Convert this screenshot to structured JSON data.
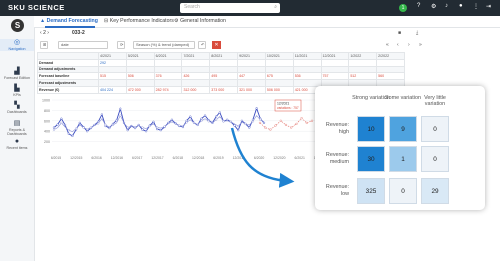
{
  "app": {
    "logo": "SKU SCIENCE",
    "search_placeholder": "Search",
    "badge": "1"
  },
  "sidebar": [
    {
      "icon": "compass-icon",
      "glyph": "◎",
      "label": "Navigation",
      "active": true
    },
    {
      "icon": "forecast-icon",
      "glyph": "▟",
      "label": "Forecast Edition"
    },
    {
      "icon": "kpi-icon",
      "glyph": "▙",
      "label": "KPIs"
    },
    {
      "icon": "dashboard-icon",
      "glyph": "▚",
      "label": "Dashboards"
    },
    {
      "icon": "reports-icon",
      "glyph": "▤",
      "label": "Reports & Dashboards"
    },
    {
      "icon": "recent-icon",
      "glyph": "●",
      "label": "Recent items"
    }
  ],
  "tabs": [
    {
      "label": "Demand Forecasting",
      "glyph": "▲",
      "active": true
    },
    {
      "label": "Key Performance Indicators",
      "glyph": "⊟"
    },
    {
      "label": "General Information",
      "glyph": "⚙"
    }
  ],
  "breadcrumb": {
    "page": "2",
    "code": "033-2"
  },
  "toolbar": {
    "period": "date",
    "filter": "Season (%) & trend (damped)"
  },
  "table": {
    "columns": [
      "",
      "4/2021",
      "5/2021",
      "6/2021",
      "7/2021",
      "8/2021",
      "9/2021",
      "10/2021",
      "11/2021",
      "12/2021",
      "1/2022",
      "2/2022"
    ],
    "rows": [
      {
        "label": "Demand",
        "values": [
          "292",
          "",
          "",
          "",
          "",
          "",
          "",
          "",
          "",
          "",
          ""
        ],
        "style": "blue"
      },
      {
        "label": "Demand adjustments",
        "values": [
          "",
          "",
          "",
          "",
          "",
          "",
          "",
          "",
          "",
          "",
          ""
        ],
        "style": "blue"
      },
      {
        "label": "Forecast baseline",
        "values": [
          "515",
          "506",
          "376",
          "426",
          "495",
          "447",
          "675",
          "536",
          "757",
          "512",
          "560"
        ],
        "style": "red"
      },
      {
        "label": "Forecast adjustments",
        "values": [
          "",
          "",
          "",
          "",
          "",
          "",
          "",
          "",
          "",
          "",
          ""
        ],
        "style": "red"
      },
      {
        "label": "Revenue (€)",
        "values": [
          "404 224",
          "472 000",
          "282 974",
          "312 000",
          "373 000",
          "321 000",
          "506 000",
          "421 000",
          "572 000",
          "389 000",
          "422 000"
        ],
        "style": "mixed"
      }
    ]
  },
  "chart_data": {
    "type": "line",
    "y_ticks": [
      "1000",
      "800",
      "600",
      "400",
      "200"
    ],
    "x_ticks": [
      "6/2015",
      "12/2015",
      "6/2016",
      "12/2016",
      "6/2017",
      "12/2017",
      "6/2018",
      "12/2018",
      "6/2019",
      "12/2019",
      "6/2020",
      "12/2020",
      "6/2021",
      "12/2021"
    ],
    "ylim": [
      0,
      1000
    ],
    "series": [
      {
        "values": [
          470,
          530,
          640,
          520,
          350,
          310,
          430,
          560,
          480,
          400,
          460,
          520,
          580,
          720,
          500,
          460,
          540,
          610,
          830,
          560,
          420,
          500,
          460,
          520,
          430,
          400,
          510,
          580,
          440,
          420,
          480,
          560,
          620,
          550,
          500,
          480,
          600,
          680,
          560,
          520,
          640,
          700,
          610,
          560,
          680,
          760,
          590,
          620,
          580,
          510,
          420,
          600,
          540,
          470,
          620,
          840,
          640,
          560
        ],
        "color": "#3b4cc0"
      },
      {
        "values": [
          430,
          470,
          560,
          480,
          420,
          390,
          450,
          520,
          470,
          440,
          470,
          510,
          550,
          640,
          520,
          480,
          520,
          560,
          700,
          560,
          470,
          500,
          480,
          510,
          470,
          450,
          500,
          540,
          470,
          460,
          490,
          540,
          580,
          540,
          510,
          500,
          570,
          620,
          560,
          530,
          600,
          640,
          590,
          560,
          620,
          680,
          590,
          600,
          580,
          540,
          500,
          570,
          540,
          520,
          590,
          700,
          620,
          580
        ],
        "color": "#8a92d6"
      },
      {
        "values": [
          560,
          470,
          430,
          510,
          600,
          520,
          470,
          540,
          650,
          560,
          600
        ],
        "color": "#e2716a"
      }
    ],
    "tooltip": {
      "title": "12/2021",
      "line2": "variations : 757"
    }
  },
  "matrix": {
    "columns": [
      "Strong variation",
      "Some variation",
      "Very little variation"
    ],
    "rows": [
      {
        "label": "Revenue: high",
        "values": [
          "10",
          "9",
          "0"
        ],
        "colors": [
          "#1f82d1",
          "#4fa3df",
          "#eef3f8"
        ]
      },
      {
        "label": "Revenue: medium",
        "values": [
          "30",
          "1",
          "0"
        ],
        "colors": [
          "#1f82d1",
          "#9ccaec",
          "#eef3f8"
        ]
      },
      {
        "label": "Revenue: low",
        "values": [
          "325",
          "0",
          "29"
        ],
        "colors": [
          "#cfe3f4",
          "#eef3f8",
          "#d9e9f6"
        ]
      }
    ]
  }
}
